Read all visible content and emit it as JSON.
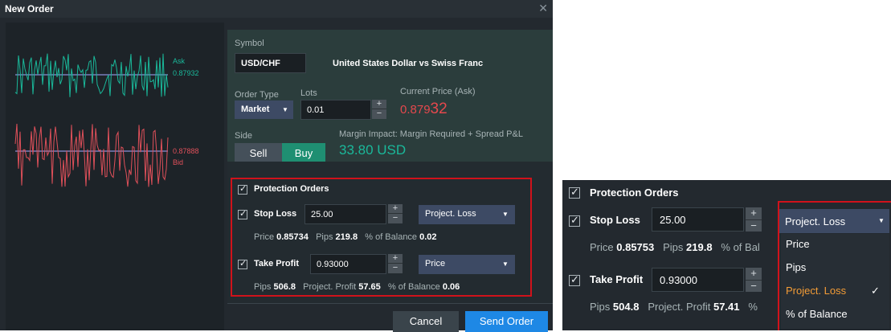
{
  "dialog": {
    "title": "New Order",
    "close_glyph": "✕",
    "chart": {
      "ask_label": "Ask",
      "ask_value": "0.87932",
      "bid_label": "Bid",
      "bid_value": "0.87888"
    },
    "symbol": {
      "label": "Symbol",
      "value": "USD/CHF",
      "description": "United States Dollar vs Swiss Franc"
    },
    "order_type": {
      "label": "Order Type",
      "value": "Market"
    },
    "lots": {
      "label": "Lots",
      "value": "0.01"
    },
    "current_price": {
      "label": "Current Price (Ask)",
      "main": "0.879",
      "pips": "32"
    },
    "side": {
      "label": "Side",
      "sell": "Sell",
      "buy": "Buy"
    },
    "margin": {
      "label": "Margin Impact: Margin Required + Spread P&L",
      "value": "33.80 USD"
    },
    "protection": {
      "title": "Protection Orders",
      "stop_loss": {
        "label": "Stop Loss",
        "value": "25.00",
        "mode": "Project. Loss",
        "price_label": "Price",
        "price": "0.85734",
        "pips_label": "Pips",
        "pips": "219.8",
        "balance_label": "% of Balance",
        "balance": "0.02"
      },
      "take_profit": {
        "label": "Take Profit",
        "value": "0.93000",
        "mode": "Price",
        "pips_label": "Pips",
        "pips": "506.8",
        "profit_label": "Project. Profit",
        "profit": "57.65",
        "balance_label": "% of Balance",
        "balance": "0.06"
      }
    },
    "footer": {
      "cancel": "Cancel",
      "send": "Send Order"
    }
  },
  "zoom": {
    "protection_title": "Protection Orders",
    "stop_loss": {
      "label": "Stop Loss",
      "value": "25.00",
      "mode": "Project. Loss",
      "price_label": "Price",
      "price": "0.85753",
      "pips_label": "Pips",
      "pips": "219.8",
      "balance_label": "% of Bal"
    },
    "take_profit": {
      "label": "Take Profit",
      "value": "0.93000",
      "pips_label": "Pips",
      "pips": "504.8",
      "profit_label": "Project. Profit",
      "profit": "57.41",
      "trailing": "%"
    },
    "dropdown": {
      "options": [
        "Price",
        "Pips",
        "Project. Loss",
        "% of Balance"
      ],
      "selected": "Project. Loss",
      "check_glyph": "✓"
    }
  },
  "colors": {
    "accent_blue": "#1e88e5",
    "buy_green": "#1f8f72",
    "ask_green": "#1ab89a",
    "bid_red": "#e0505a",
    "price_red": "#e5484d",
    "selected_orange": "#f39c36",
    "highlight_red": "#d0121b"
  }
}
